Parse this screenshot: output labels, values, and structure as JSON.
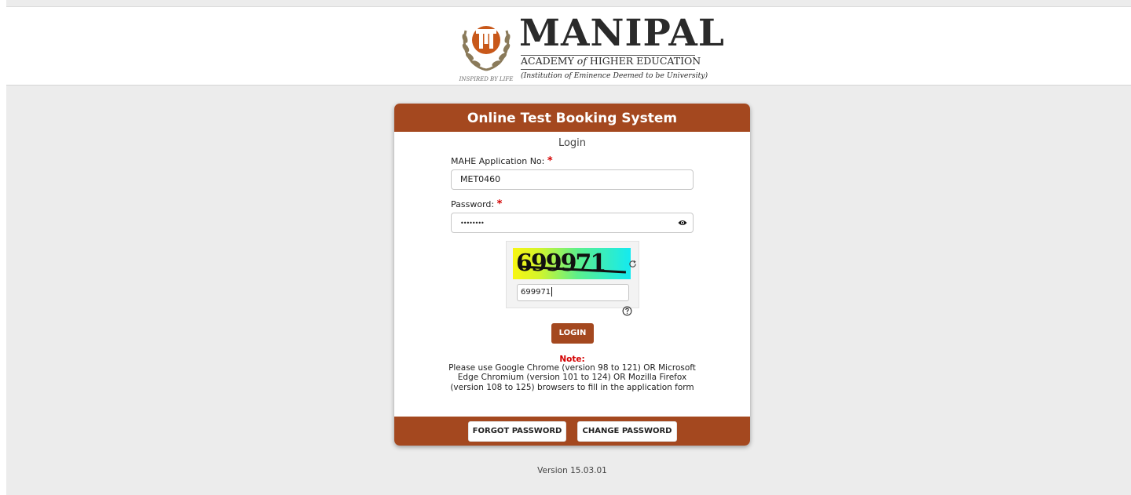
{
  "header": {
    "logo": {
      "title": "MANIPAL",
      "subtitle_part1": "ACADEMY ",
      "subtitle_of": "of",
      "subtitle_part2": " HIGHER EDUCATION",
      "tagline": "(Institution of Eminence Deemed to be University)",
      "emblem_text": "INSPIRED BY LIFE"
    }
  },
  "card": {
    "title": "Online Test Booking System",
    "heading": "Login",
    "application_no": {
      "label": "MAHE Application No:",
      "required_mark": "*",
      "value": "MET0460"
    },
    "password": {
      "label": "Password:",
      "required_mark": "*",
      "value": "••••••••"
    },
    "captcha": {
      "image_text": "699971",
      "input_value": "699971"
    },
    "login_label": "LOGIN",
    "note": {
      "title": "Note:",
      "body": "Please use Google Chrome (version 98 to 121) OR Microsoft Edge Chromium (version 101 to 124) OR Mozilla Firefox (version 108 to 125) browsers to fill in the application form"
    },
    "footer": {
      "forgot_password": "FORGOT PASSWORD",
      "change_password": "CHANGE PASSWORD"
    }
  },
  "version": "Version 15.03.01",
  "colors": {
    "accent": "#a4481f",
    "page_bg": "#ececec",
    "required": "#d40000"
  }
}
